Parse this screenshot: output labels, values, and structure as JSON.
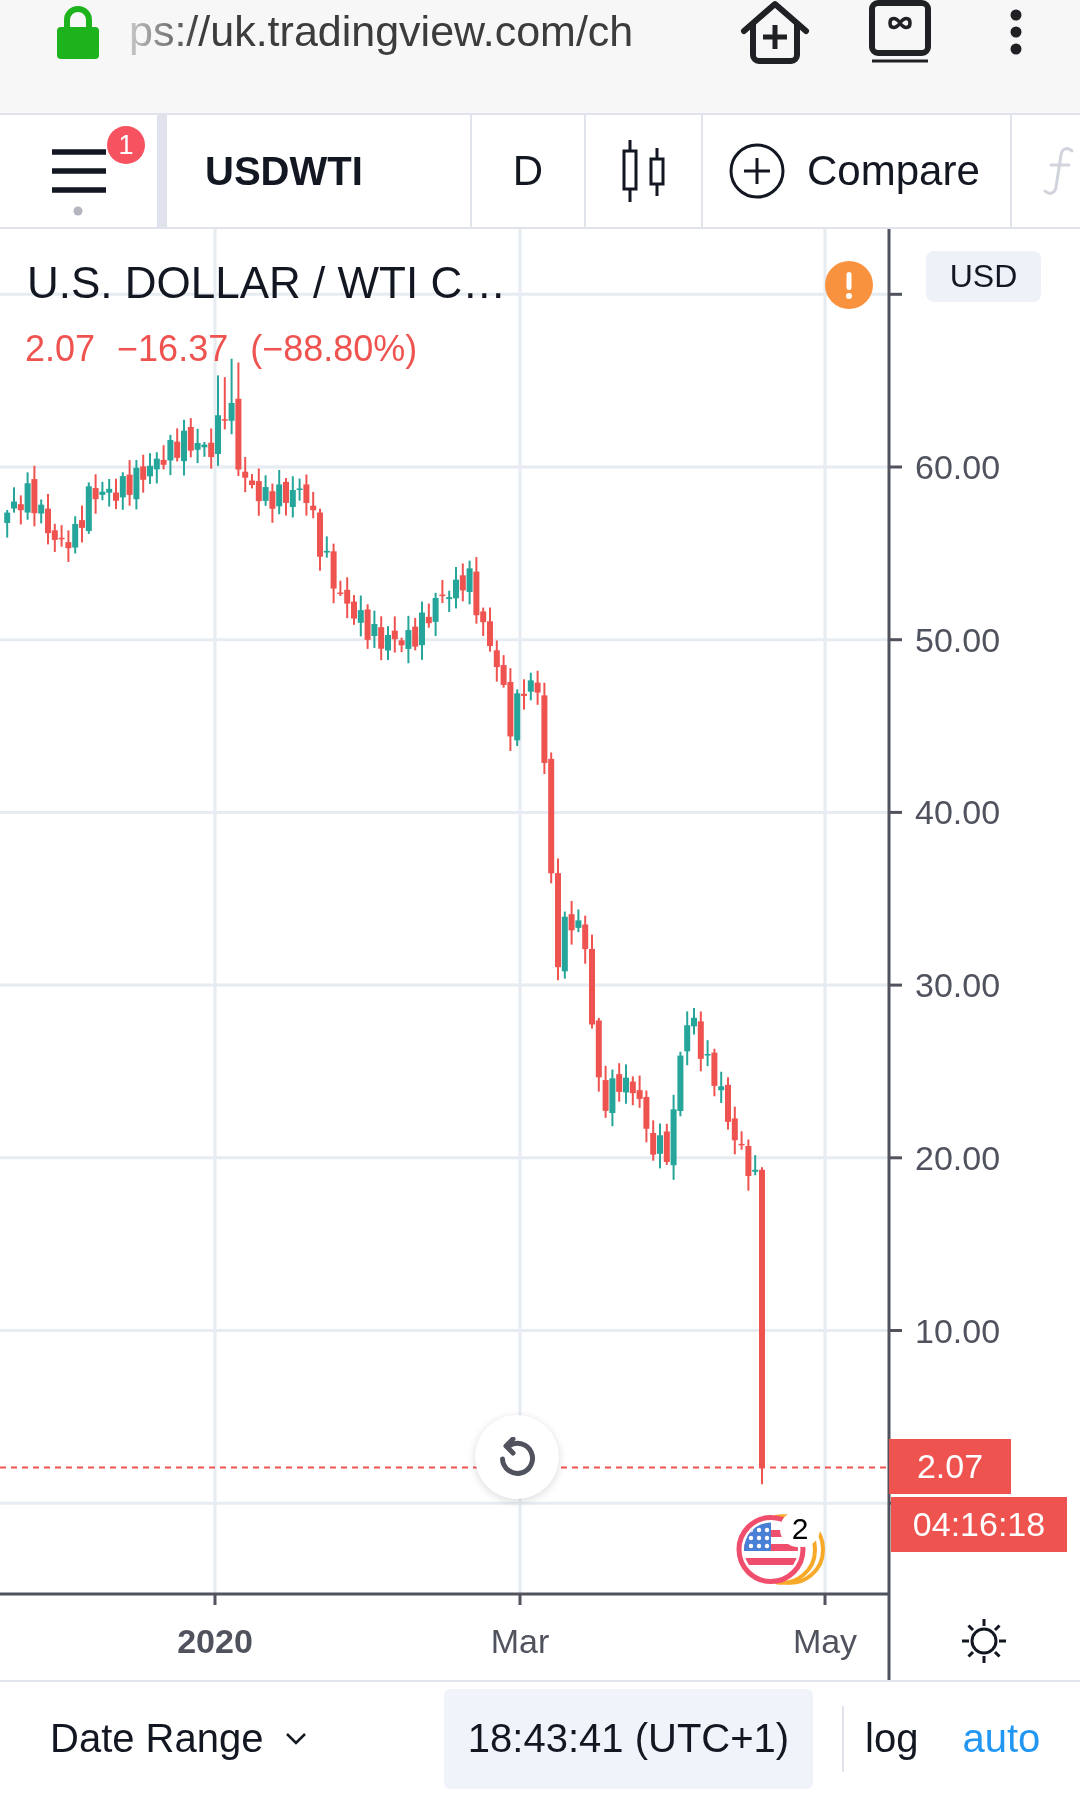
{
  "browser_bar": {
    "url": "ps://uk.tradingview.com/ch"
  },
  "toolbar": {
    "notification_count": "1",
    "symbol": "USDWTI",
    "interval": "D",
    "compare": "Compare"
  },
  "legend": {
    "title": "U.S. DOLLAR / WTI C…",
    "last_price": "2.07",
    "change": "−16.37",
    "change_percent": "(−88.80%)"
  },
  "price_axis": {
    "currency": "USD",
    "labels": [
      "60.00",
      "50.00",
      "40.00",
      "30.00",
      "20.00",
      "10.00"
    ],
    "last_price": "2.07",
    "countdown": "04:16:18"
  },
  "events": {
    "count": "2"
  },
  "time_axis": {
    "labels": [
      {
        "text": "2020",
        "kind": "year"
      },
      {
        "text": "Mar",
        "kind": "month"
      },
      {
        "text": "May",
        "kind": "month"
      }
    ]
  },
  "bottom_bar": {
    "date_range": "Date Range",
    "clock": "18:43:41 (UTC+1)",
    "scale_options": [
      {
        "label": "log",
        "on": false
      },
      {
        "label": "auto",
        "on": true
      }
    ]
  }
}
